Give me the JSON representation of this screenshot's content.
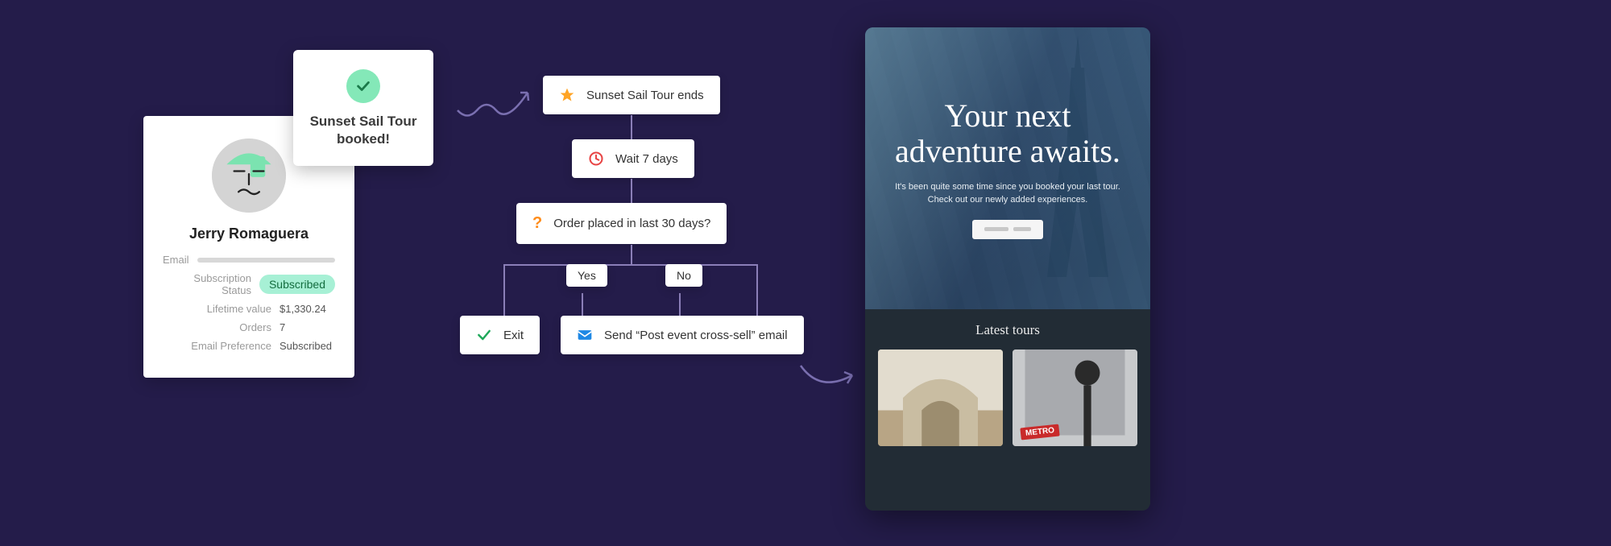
{
  "toast": {
    "text": "Sunset Sail Tour booked!"
  },
  "profile": {
    "name": "Jerry Romaguera",
    "email_label": "Email",
    "subscription_label": "Subscription Status",
    "subscription_badge": "Subscribed",
    "lifetime_label": "Lifetime value",
    "lifetime_value": "$1,330.24",
    "orders_label": "Orders",
    "orders_value": "7",
    "email_pref_label": "Email Preference",
    "email_pref_value": "Subscribed"
  },
  "flow": {
    "trigger": "Sunset Sail Tour ends",
    "wait": "Wait 7 days",
    "condition": "Order placed in last 30 days?",
    "yes": "Yes",
    "no": "No",
    "exit": "Exit",
    "send_email": "Send “Post event cross-sell” email"
  },
  "email": {
    "hero_title": "Your next adventure awaits.",
    "hero_sub": "It's been quite some time since you booked your last tour. Check out our newly added experiences.",
    "tours_heading": "Latest tours",
    "metro_label": "METRO"
  }
}
